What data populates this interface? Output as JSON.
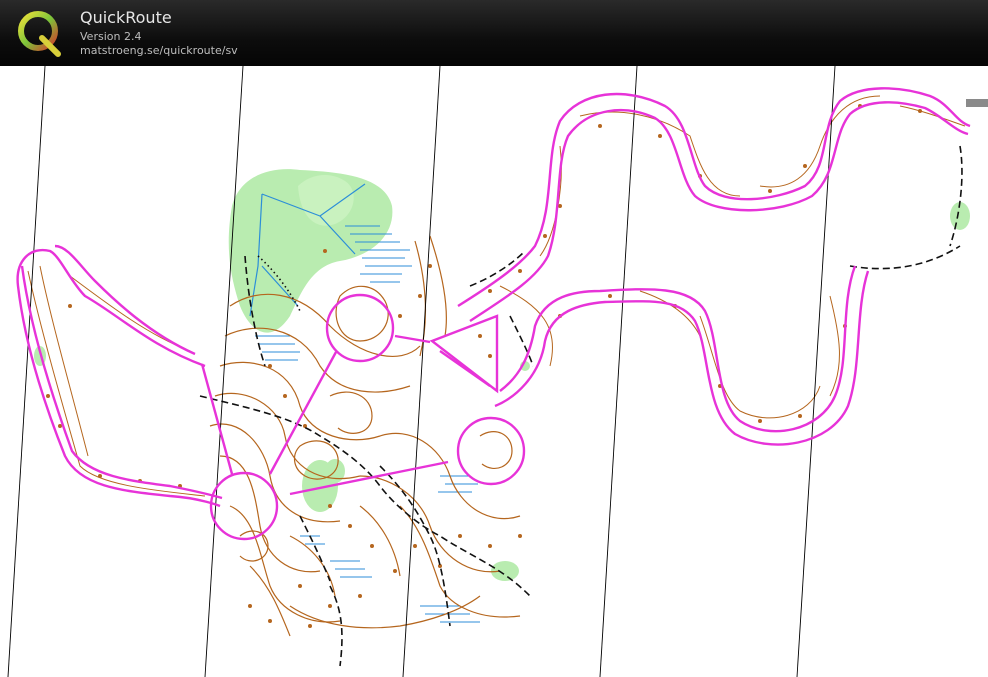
{
  "header": {
    "logo_letter": "Q",
    "app_title": "QuickRoute",
    "version": "Version 2.4",
    "url": "matstroeng.se/quickroute/sv"
  },
  "colors": {
    "route": "#e733d8",
    "contour": "#b5661e",
    "vegetation": "#b9ecb0",
    "water": "#2c8ed8",
    "north_line": "#000000",
    "header_bg": "#111111"
  },
  "icons": {
    "logo": "quickroute-q-logo-icon"
  }
}
